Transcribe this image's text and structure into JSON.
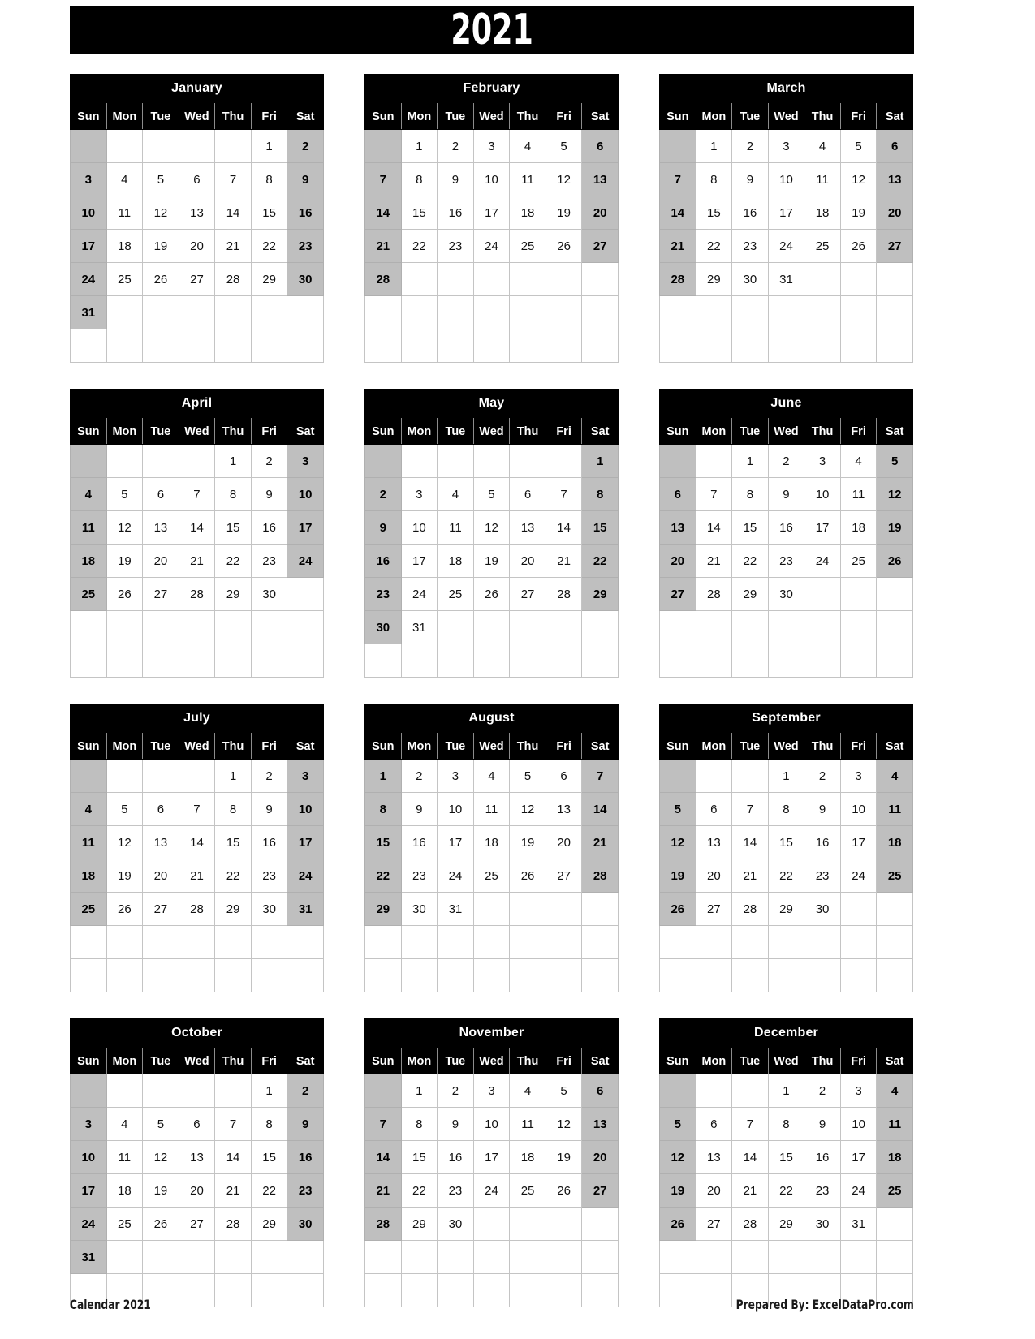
{
  "header": {
    "year": "2021"
  },
  "weekday_headers": [
    "Sun",
    "Mon",
    "Tue",
    "Wed",
    "Thu",
    "Fri",
    "Sat"
  ],
  "weekend_columns": [
    0,
    6
  ],
  "footer": {
    "left": "Calendar 2021",
    "right": "Prepared By: ExcelDataPro.com"
  },
  "colors": {
    "header_bg": "#000000",
    "header_text": "#ffffff",
    "weekend_bg": "#bfbfbf",
    "weekday_bg": "#ffffff",
    "cell_border": "#c4c4c4",
    "text": "#111111"
  },
  "months": [
    {
      "name": "January",
      "rows": [
        [
          "",
          "",
          "",
          "",
          "",
          "1",
          "2"
        ],
        [
          "3",
          "4",
          "5",
          "6",
          "7",
          "8",
          "9"
        ],
        [
          "10",
          "11",
          "12",
          "13",
          "14",
          "15",
          "16"
        ],
        [
          "17",
          "18",
          "19",
          "20",
          "21",
          "22",
          "23"
        ],
        [
          "24",
          "25",
          "26",
          "27",
          "28",
          "29",
          "30"
        ],
        [
          "31",
          "",
          "",
          "",
          "",
          "",
          ""
        ],
        [
          "",
          "",
          "",
          "",
          "",
          "",
          ""
        ]
      ]
    },
    {
      "name": "February",
      "rows": [
        [
          "",
          "1",
          "2",
          "3",
          "4",
          "5",
          "6"
        ],
        [
          "7",
          "8",
          "9",
          "10",
          "11",
          "12",
          "13"
        ],
        [
          "14",
          "15",
          "16",
          "17",
          "18",
          "19",
          "20"
        ],
        [
          "21",
          "22",
          "23",
          "24",
          "25",
          "26",
          "27"
        ],
        [
          "28",
          "",
          "",
          "",
          "",
          "",
          ""
        ],
        [
          "",
          "",
          "",
          "",
          "",
          "",
          ""
        ],
        [
          "",
          "",
          "",
          "",
          "",
          "",
          ""
        ]
      ]
    },
    {
      "name": "March",
      "rows": [
        [
          "",
          "1",
          "2",
          "3",
          "4",
          "5",
          "6"
        ],
        [
          "7",
          "8",
          "9",
          "10",
          "11",
          "12",
          "13"
        ],
        [
          "14",
          "15",
          "16",
          "17",
          "18",
          "19",
          "20"
        ],
        [
          "21",
          "22",
          "23",
          "24",
          "25",
          "26",
          "27"
        ],
        [
          "28",
          "29",
          "30",
          "31",
          "",
          "",
          ""
        ],
        [
          "",
          "",
          "",
          "",
          "",
          "",
          ""
        ],
        [
          "",
          "",
          "",
          "",
          "",
          "",
          ""
        ]
      ]
    },
    {
      "name": "April",
      "rows": [
        [
          "",
          "",
          "",
          "",
          "1",
          "2",
          "3"
        ],
        [
          "4",
          "5",
          "6",
          "7",
          "8",
          "9",
          "10"
        ],
        [
          "11",
          "12",
          "13",
          "14",
          "15",
          "16",
          "17"
        ],
        [
          "18",
          "19",
          "20",
          "21",
          "22",
          "23",
          "24"
        ],
        [
          "25",
          "26",
          "27",
          "28",
          "29",
          "30",
          ""
        ],
        [
          "",
          "",
          "",
          "",
          "",
          "",
          ""
        ],
        [
          "",
          "",
          "",
          "",
          "",
          "",
          ""
        ]
      ]
    },
    {
      "name": "May",
      "rows": [
        [
          "",
          "",
          "",
          "",
          "",
          "",
          "1"
        ],
        [
          "2",
          "3",
          "4",
          "5",
          "6",
          "7",
          "8"
        ],
        [
          "9",
          "10",
          "11",
          "12",
          "13",
          "14",
          "15"
        ],
        [
          "16",
          "17",
          "18",
          "19",
          "20",
          "21",
          "22"
        ],
        [
          "23",
          "24",
          "25",
          "26",
          "27",
          "28",
          "29"
        ],
        [
          "30",
          "31",
          "",
          "",
          "",
          "",
          ""
        ],
        [
          "",
          "",
          "",
          "",
          "",
          "",
          ""
        ]
      ]
    },
    {
      "name": "June",
      "rows": [
        [
          "",
          "",
          "1",
          "2",
          "3",
          "4",
          "5"
        ],
        [
          "6",
          "7",
          "8",
          "9",
          "10",
          "11",
          "12"
        ],
        [
          "13",
          "14",
          "15",
          "16",
          "17",
          "18",
          "19"
        ],
        [
          "20",
          "21",
          "22",
          "23",
          "24",
          "25",
          "26"
        ],
        [
          "27",
          "28",
          "29",
          "30",
          "",
          "",
          ""
        ],
        [
          "",
          "",
          "",
          "",
          "",
          "",
          ""
        ],
        [
          "",
          "",
          "",
          "",
          "",
          "",
          ""
        ]
      ]
    },
    {
      "name": "July",
      "rows": [
        [
          "",
          "",
          "",
          "",
          "1",
          "2",
          "3"
        ],
        [
          "4",
          "5",
          "6",
          "7",
          "8",
          "9",
          "10"
        ],
        [
          "11",
          "12",
          "13",
          "14",
          "15",
          "16",
          "17"
        ],
        [
          "18",
          "19",
          "20",
          "21",
          "22",
          "23",
          "24"
        ],
        [
          "25",
          "26",
          "27",
          "28",
          "29",
          "30",
          "31"
        ],
        [
          "",
          "",
          "",
          "",
          "",
          "",
          ""
        ],
        [
          "",
          "",
          "",
          "",
          "",
          "",
          ""
        ]
      ]
    },
    {
      "name": "August",
      "rows": [
        [
          "1",
          "2",
          "3",
          "4",
          "5",
          "6",
          "7"
        ],
        [
          "8",
          "9",
          "10",
          "11",
          "12",
          "13",
          "14"
        ],
        [
          "15",
          "16",
          "17",
          "18",
          "19",
          "20",
          "21"
        ],
        [
          "22",
          "23",
          "24",
          "25",
          "26",
          "27",
          "28"
        ],
        [
          "29",
          "30",
          "31",
          "",
          "",
          "",
          ""
        ],
        [
          "",
          "",
          "",
          "",
          "",
          "",
          ""
        ],
        [
          "",
          "",
          "",
          "",
          "",
          "",
          ""
        ]
      ]
    },
    {
      "name": "September",
      "rows": [
        [
          "",
          "",
          "",
          "1",
          "2",
          "3",
          "4"
        ],
        [
          "5",
          "6",
          "7",
          "8",
          "9",
          "10",
          "11"
        ],
        [
          "12",
          "13",
          "14",
          "15",
          "16",
          "17",
          "18"
        ],
        [
          "19",
          "20",
          "21",
          "22",
          "23",
          "24",
          "25"
        ],
        [
          "26",
          "27",
          "28",
          "29",
          "30",
          "",
          ""
        ],
        [
          "",
          "",
          "",
          "",
          "",
          "",
          ""
        ],
        [
          "",
          "",
          "",
          "",
          "",
          "",
          ""
        ]
      ]
    },
    {
      "name": "October",
      "rows": [
        [
          "",
          "",
          "",
          "",
          "",
          "1",
          "2"
        ],
        [
          "3",
          "4",
          "5",
          "6",
          "7",
          "8",
          "9"
        ],
        [
          "10",
          "11",
          "12",
          "13",
          "14",
          "15",
          "16"
        ],
        [
          "17",
          "18",
          "19",
          "20",
          "21",
          "22",
          "23"
        ],
        [
          "24",
          "25",
          "26",
          "27",
          "28",
          "29",
          "30"
        ],
        [
          "31",
          "",
          "",
          "",
          "",
          "",
          ""
        ],
        [
          "",
          "",
          "",
          "",
          "",
          "",
          ""
        ]
      ]
    },
    {
      "name": "November",
      "rows": [
        [
          "",
          "1",
          "2",
          "3",
          "4",
          "5",
          "6"
        ],
        [
          "7",
          "8",
          "9",
          "10",
          "11",
          "12",
          "13"
        ],
        [
          "14",
          "15",
          "16",
          "17",
          "18",
          "19",
          "20"
        ],
        [
          "21",
          "22",
          "23",
          "24",
          "25",
          "26",
          "27"
        ],
        [
          "28",
          "29",
          "30",
          "",
          "",
          "",
          ""
        ],
        [
          "",
          "",
          "",
          "",
          "",
          "",
          ""
        ],
        [
          "",
          "",
          "",
          "",
          "",
          "",
          ""
        ]
      ]
    },
    {
      "name": "December",
      "rows": [
        [
          "",
          "",
          "",
          "1",
          "2",
          "3",
          "4"
        ],
        [
          "5",
          "6",
          "7",
          "8",
          "9",
          "10",
          "11"
        ],
        [
          "12",
          "13",
          "14",
          "15",
          "16",
          "17",
          "18"
        ],
        [
          "19",
          "20",
          "21",
          "22",
          "23",
          "24",
          "25"
        ],
        [
          "26",
          "27",
          "28",
          "29",
          "30",
          "31",
          ""
        ],
        [
          "",
          "",
          "",
          "",
          "",
          "",
          ""
        ],
        [
          "",
          "",
          "",
          "",
          "",
          "",
          ""
        ]
      ]
    }
  ]
}
